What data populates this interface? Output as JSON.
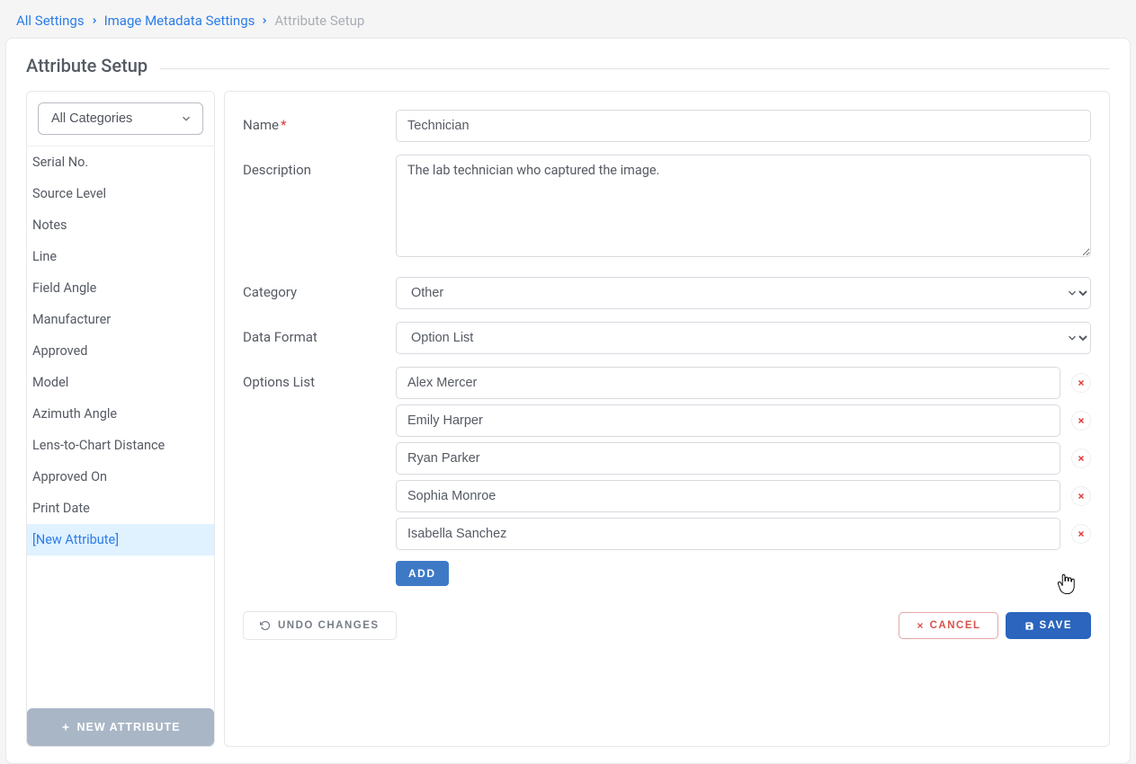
{
  "breadcrumb": {
    "items": [
      "All Settings",
      "Image Metadata Settings",
      "Attribute Setup"
    ]
  },
  "page": {
    "title": "Attribute Setup"
  },
  "sidebar": {
    "category_selected": "All Categories",
    "items": [
      {
        "label": "Serial No."
      },
      {
        "label": "Source Level"
      },
      {
        "label": "Notes"
      },
      {
        "label": "Line"
      },
      {
        "label": "Field Angle"
      },
      {
        "label": "Manufacturer"
      },
      {
        "label": "Approved"
      },
      {
        "label": "Model"
      },
      {
        "label": "Azimuth Angle"
      },
      {
        "label": "Lens-to-Chart Distance"
      },
      {
        "label": "Approved On"
      },
      {
        "label": "Print Date"
      },
      {
        "label": "[New Attribute]",
        "active": true
      }
    ],
    "new_button": "NEW ATTRIBUTE"
  },
  "form": {
    "labels": {
      "name": "Name",
      "description": "Description",
      "category": "Category",
      "data_format": "Data Format",
      "options_list": "Options List"
    },
    "name_value": "Technician",
    "description_value": "The lab technician who captured the image.",
    "category_value": "Other",
    "data_format_value": "Option List",
    "options": [
      "Alex Mercer",
      "Emily Harper",
      "Ryan Parker",
      "Sophia Monroe",
      "Isabella Sanchez"
    ],
    "add_button": "ADD"
  },
  "actions": {
    "undo": "UNDO CHANGES",
    "cancel": "CANCEL",
    "save": "SAVE"
  }
}
